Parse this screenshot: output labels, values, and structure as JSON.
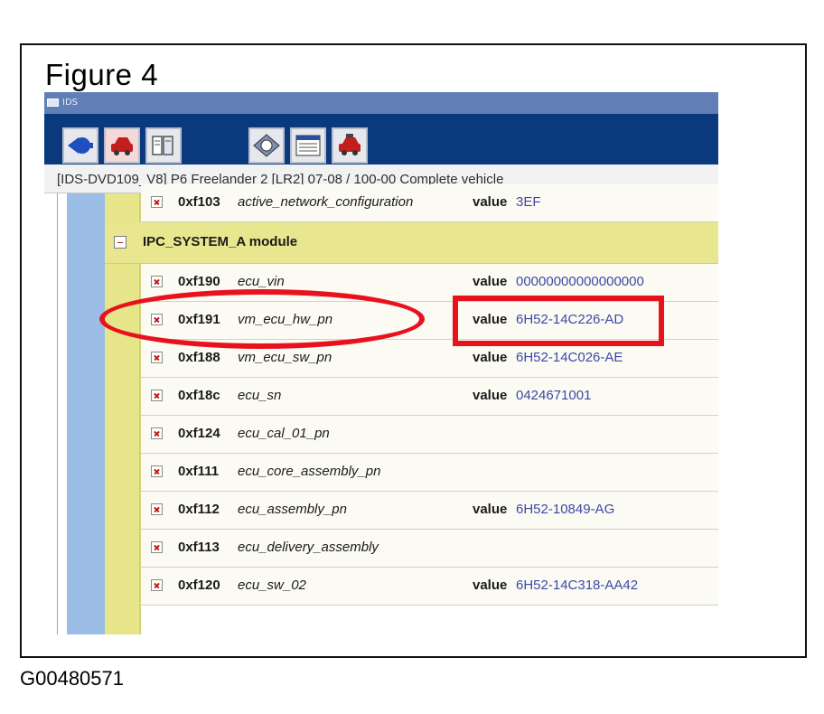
{
  "figure": {
    "title": "Figure 4",
    "id": "G00480571"
  },
  "window": {
    "title": "IDS"
  },
  "toolbar": {
    "buttons": [
      {
        "icon": "back-arrow-icon"
      },
      {
        "icon": "vehicle-icon"
      },
      {
        "icon": "toolbox-icon"
      },
      {
        "icon": "session-icon"
      },
      {
        "icon": "list-view-icon"
      },
      {
        "icon": "vehicle-config-icon"
      }
    ]
  },
  "context": {
    "text": "[IDS-DVD109_V8] P6   Freelander 2 [LR2] 07-08 / 100-00 Complete vehicle"
  },
  "tree": {
    "top_row": {
      "code": "0xf103",
      "name": "active_network_configuration",
      "value_label": "value",
      "value": "3EF"
    },
    "module": {
      "label": "IPC_SYSTEM_A module"
    },
    "rows": [
      {
        "code": "0xf190",
        "name": "ecu_vin",
        "value_label": "value",
        "value": "00000000000000000"
      },
      {
        "code": "0xf191",
        "name": "vm_ecu_hw_pn",
        "value_label": "value",
        "value": "6H52-14C226-AD"
      },
      {
        "code": "0xf188",
        "name": "vm_ecu_sw_pn",
        "value_label": "value",
        "value": "6H52-14C026-AE"
      },
      {
        "code": "0xf18c",
        "name": "ecu_sn",
        "value_label": "value",
        "value": "0424671001"
      },
      {
        "code": "0xf124",
        "name": "ecu_cal_01_pn",
        "value_label": "",
        "value": ""
      },
      {
        "code": "0xf111",
        "name": "ecu_core_assembly_pn",
        "value_label": "",
        "value": ""
      },
      {
        "code": "0xf112",
        "name": "ecu_assembly_pn",
        "value_label": "value",
        "value": "6H52-10849-AG"
      },
      {
        "code": "0xf113",
        "name": "ecu_delivery_assembly",
        "value_label": "",
        "value": ""
      },
      {
        "code": "0xf120",
        "name": "ecu_sw_02",
        "value_label": "value",
        "value": "6H52-14C318-AA42"
      }
    ]
  },
  "colors": {
    "highlight": "#e8121e",
    "toolbar": "#0a3a7d",
    "module_bg": "#e8e78f",
    "value_text": "#3c4aa6"
  }
}
